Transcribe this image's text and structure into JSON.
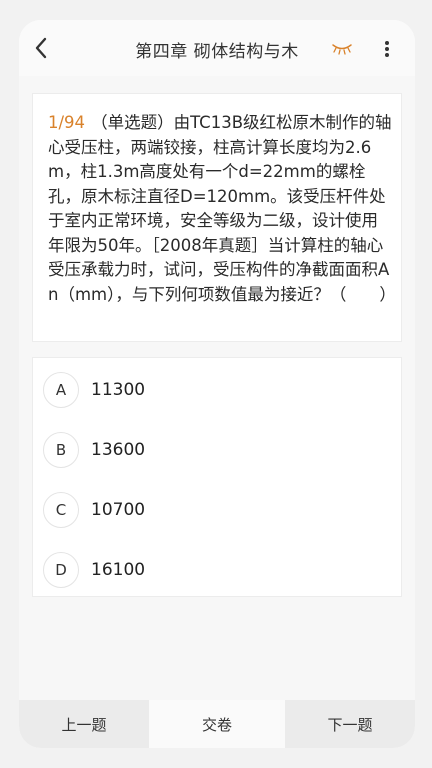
{
  "header": {
    "title": "第四章 砌体结构与木",
    "back_icon": "chevron-left-icon",
    "eye_icon": "eye-closed-icon",
    "more_icon": "more-vertical-icon",
    "eye_color": "#d9822b"
  },
  "question": {
    "number": "1/94",
    "text": "（单选题）由TC13B级红松原木制作的轴心受压柱，两端铰接，柱高计算长度均为2.6m，柱1.3m高度处有一个d=22mm的螺栓孔，原木标注直径D=120mm。该受压杆件处于室内正常环境，安全等级为二级，设计使用年限为50年。［2008年真题］当计算柱的轴心受压承载力时，试问，受压构件的净截面面积An（mm），与下列何项数值最为接近？（　　）"
  },
  "options": [
    {
      "letter": "A",
      "value": "11300"
    },
    {
      "letter": "B",
      "value": "13600"
    },
    {
      "letter": "C",
      "value": "10700"
    },
    {
      "letter": "D",
      "value": "16100"
    }
  ],
  "footer": {
    "prev_label": "上一题",
    "submit_label": "交卷",
    "next_label": "下一题"
  }
}
